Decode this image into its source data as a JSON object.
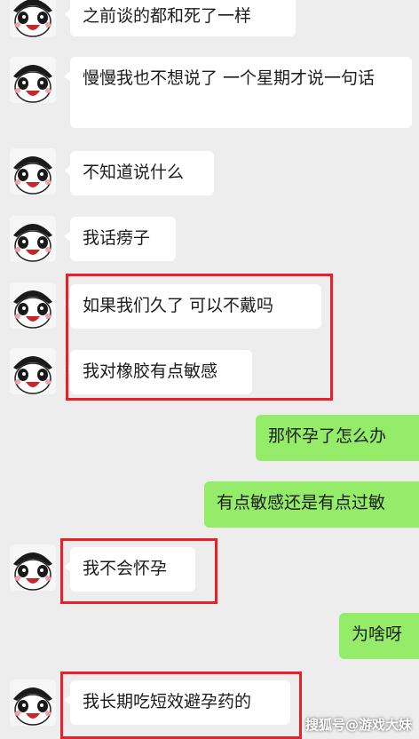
{
  "messages": [
    {
      "side": "left",
      "text": "之前谈的都和死了一样"
    },
    {
      "side": "left",
      "text": "慢慢我也不想说了 一个星期才说一句话"
    },
    {
      "side": "left",
      "text": "不知道说什么"
    },
    {
      "side": "left",
      "text": "我话痨子"
    },
    {
      "side": "left",
      "text": "如果我们久了 可以不戴吗"
    },
    {
      "side": "left",
      "text": "我对橡胶有点敏感"
    },
    {
      "side": "right",
      "text": "那怀孕了怎么办"
    },
    {
      "side": "right",
      "text": "有点敏感还是有点过敏"
    },
    {
      "side": "left",
      "text": "我不会怀孕"
    },
    {
      "side": "right",
      "text": "为啥呀"
    },
    {
      "side": "left",
      "text": "我长期吃短效避孕药的"
    }
  ],
  "watermark": "搜狐号@游戏大妹",
  "colors": {
    "background": "#ededed",
    "left_bubble": "#ffffff",
    "right_bubble": "#95ec69",
    "highlight": "#e8202a"
  },
  "icons": {
    "avatar": "panda-avatar-icon"
  }
}
